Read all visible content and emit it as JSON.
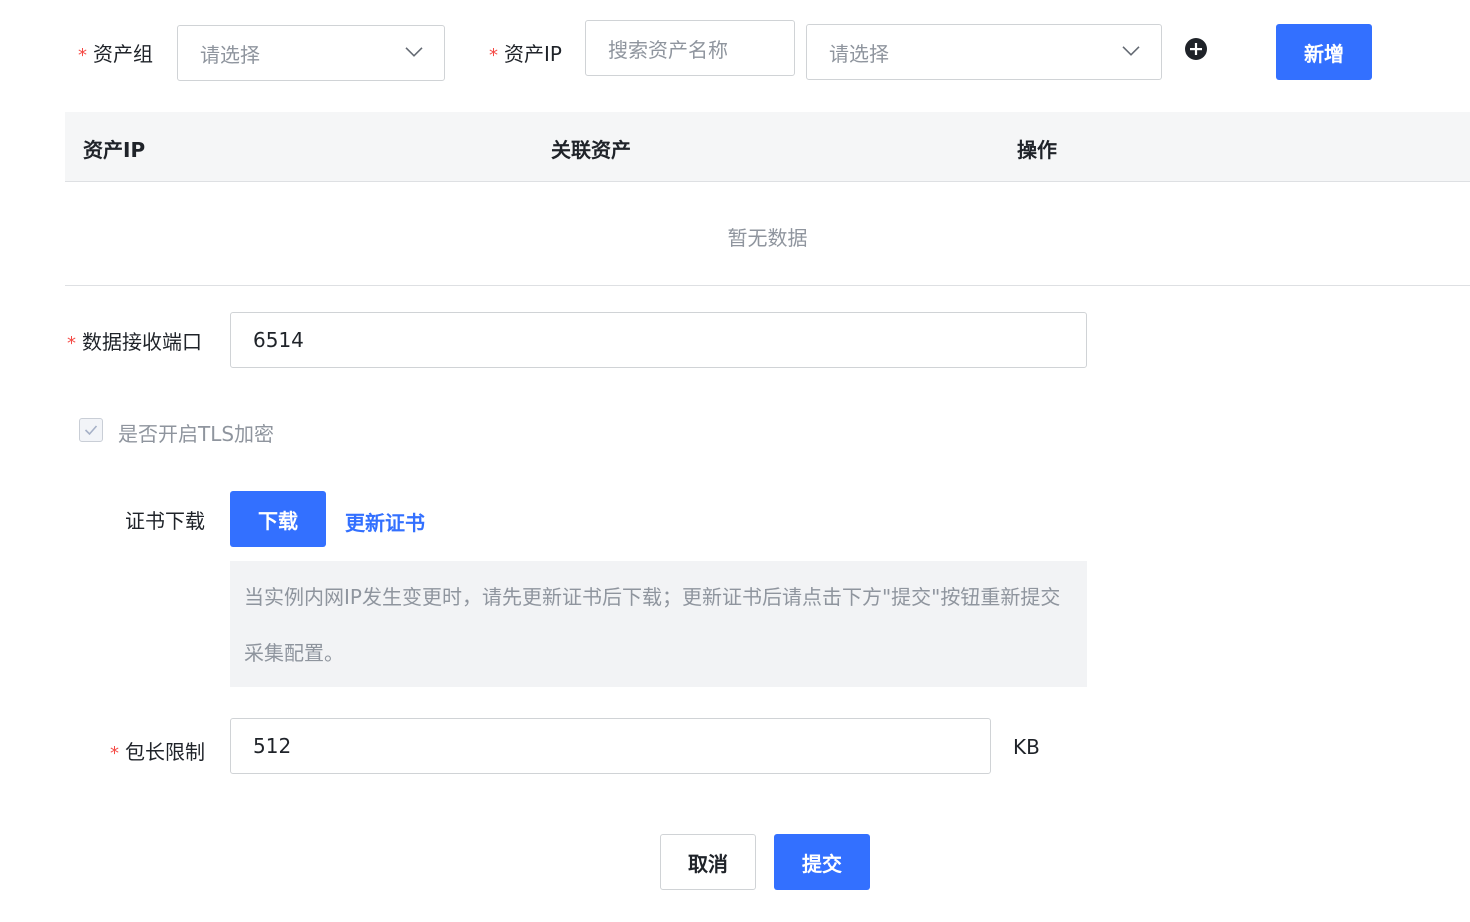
{
  "asset_group": {
    "label": "资产组",
    "placeholder": "请选择"
  },
  "asset_ip": {
    "label": "资产IP",
    "search_placeholder": "搜索资产名称",
    "select_placeholder": "请选择",
    "add_button": "新增"
  },
  "table": {
    "columns": [
      "资产IP",
      "关联资产",
      "操作"
    ],
    "empty_text": "暂无数据"
  },
  "port": {
    "label": "数据接收端口",
    "value": "6514"
  },
  "tls": {
    "label": "是否开启TLS加密",
    "checked": true
  },
  "cert": {
    "label": "证书下载",
    "download_button": "下载",
    "update_link": "更新证书",
    "tip": "当实例内网IP发生变更时，请先更新证书后下载；更新证书后请点击下方\"提交\"按钮重新提交采集配置。"
  },
  "packet": {
    "label": "包长限制",
    "value": "512",
    "unit": "KB"
  },
  "footer": {
    "cancel": "取消",
    "submit": "提交"
  },
  "colors": {
    "primary": "#3370ff",
    "required": "#f54a45"
  },
  "icons": [
    "chevron-down-icon",
    "plus-circle-icon",
    "check-icon"
  ]
}
